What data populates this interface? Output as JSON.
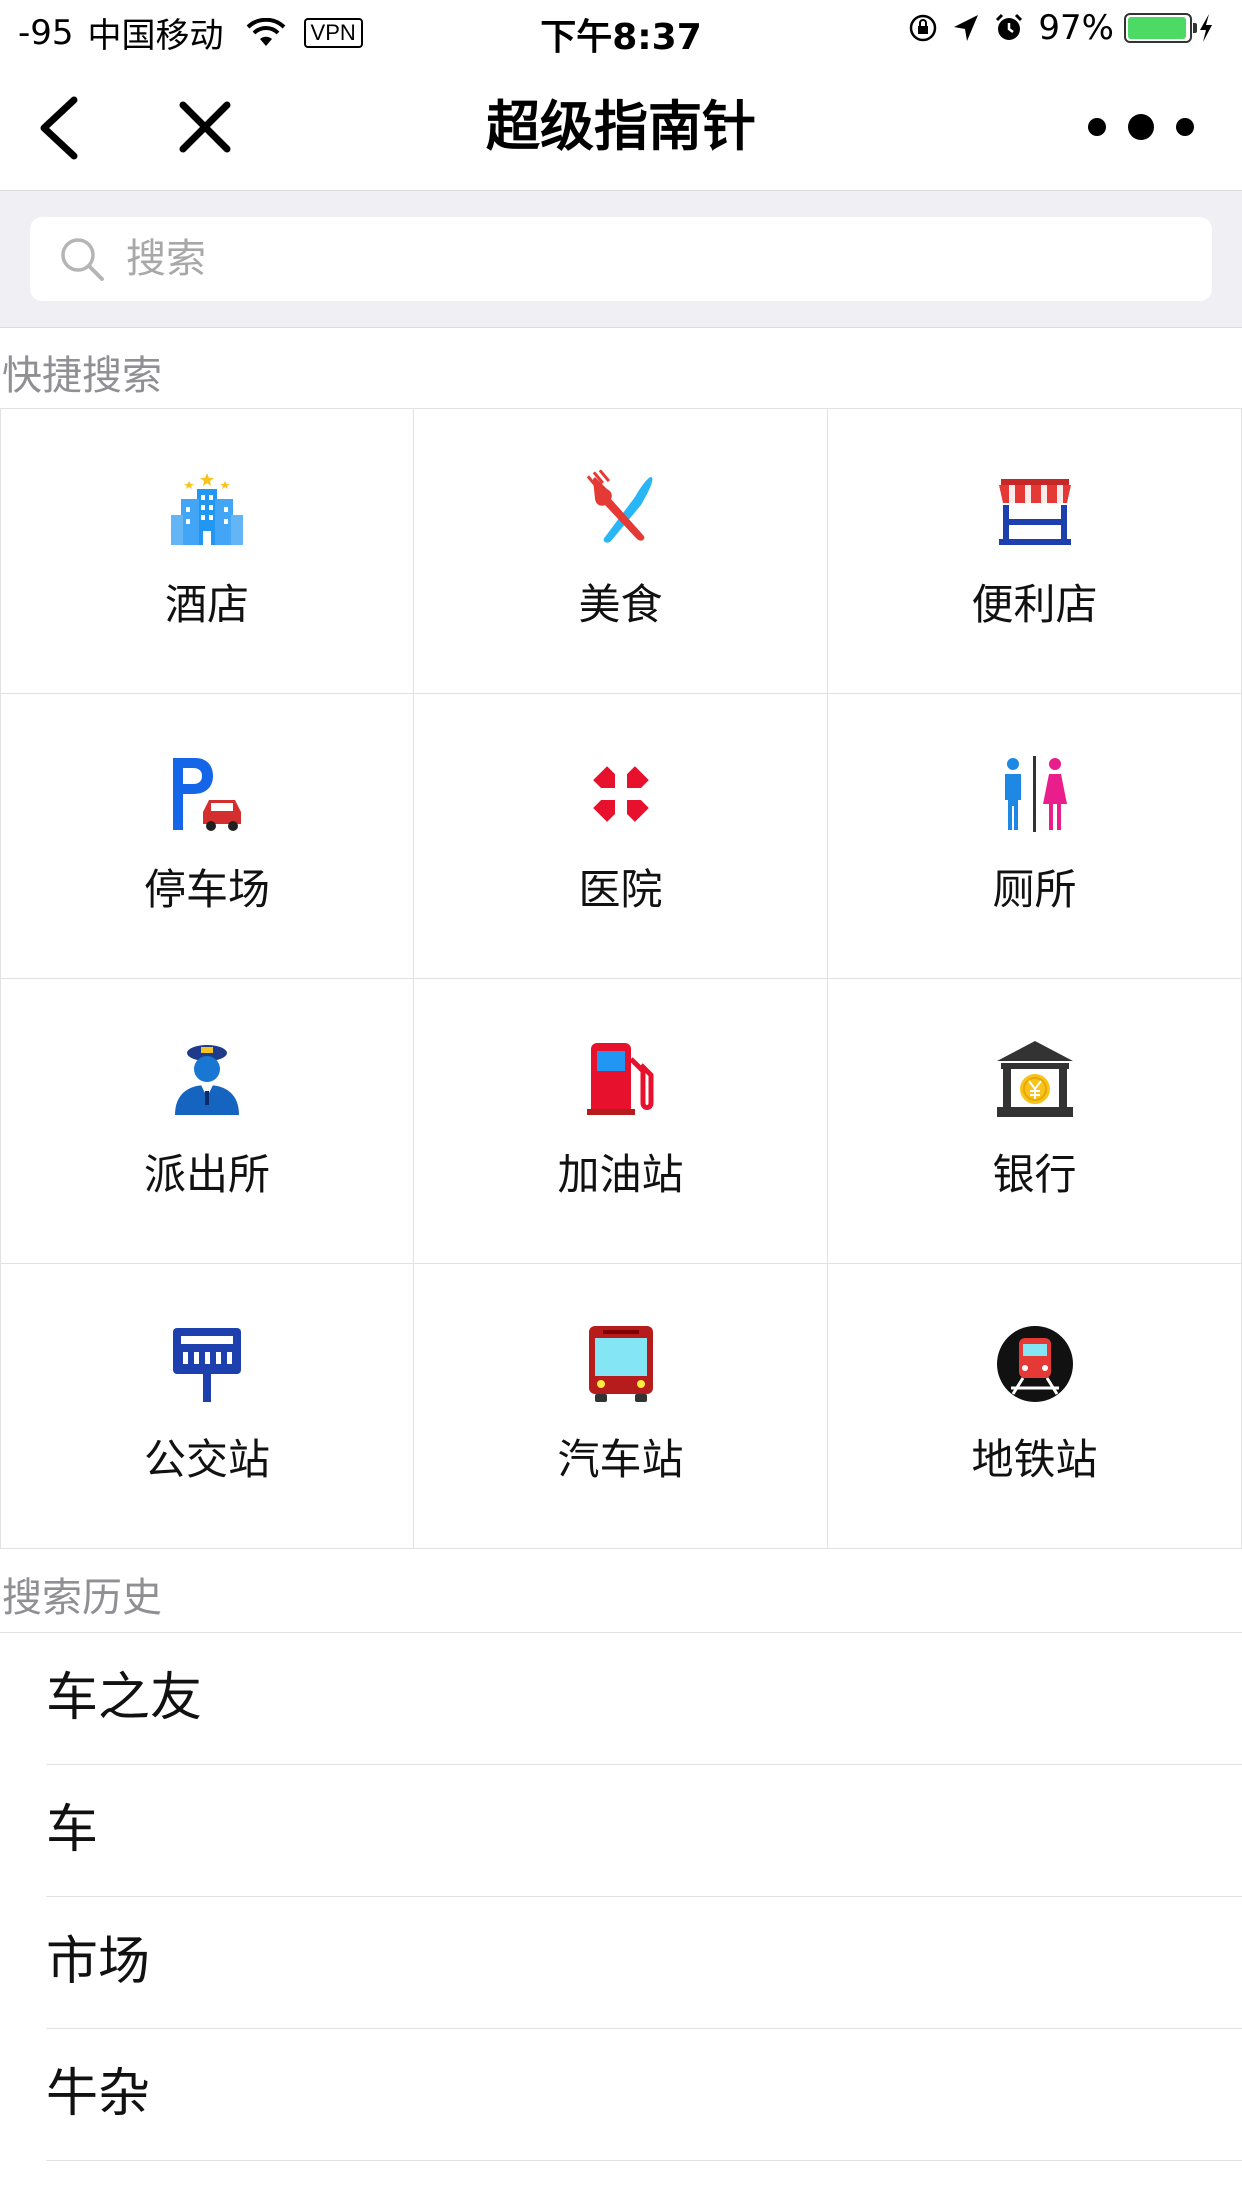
{
  "status_bar": {
    "signal": "-95",
    "carrier": "中国移动",
    "vpn": "VPN",
    "time": "下午8:37",
    "battery_percent": "97%",
    "battery_level": 0.97,
    "icons": [
      "wifi-icon",
      "orientation-lock-icon",
      "location-arrow-icon",
      "alarm-icon",
      "battery-icon",
      "charging-bolt-icon"
    ]
  },
  "nav": {
    "title": "超级指南针",
    "back_icon": "chevron-left-icon",
    "close_icon": "close-icon",
    "more_icon": "more-dots-icon"
  },
  "search": {
    "placeholder": "搜索",
    "value": ""
  },
  "quick_search": {
    "header": "快捷搜索",
    "items": [
      {
        "label": "酒店",
        "icon": "hotel-icon"
      },
      {
        "label": "美食",
        "icon": "food-icon"
      },
      {
        "label": "便利店",
        "icon": "convenience-store-icon"
      },
      {
        "label": "停车场",
        "icon": "parking-icon"
      },
      {
        "label": "医院",
        "icon": "hospital-icon"
      },
      {
        "label": "厕所",
        "icon": "toilet-icon"
      },
      {
        "label": "派出所",
        "icon": "police-icon"
      },
      {
        "label": "加油站",
        "icon": "gas-station-icon"
      },
      {
        "label": "银行",
        "icon": "bank-icon"
      },
      {
        "label": "公交站",
        "icon": "bus-stop-icon"
      },
      {
        "label": "汽车站",
        "icon": "bus-station-icon"
      },
      {
        "label": "地铁站",
        "icon": "subway-icon"
      }
    ]
  },
  "history": {
    "header": "搜索历史",
    "items": [
      "车之友",
      "车",
      "市场",
      "牛杂"
    ]
  },
  "colors": {
    "accent_green": "#4cd964",
    "search_bg": "#efeff4",
    "header_gray": "#8f8f94",
    "divider": "#e2e2e2"
  }
}
